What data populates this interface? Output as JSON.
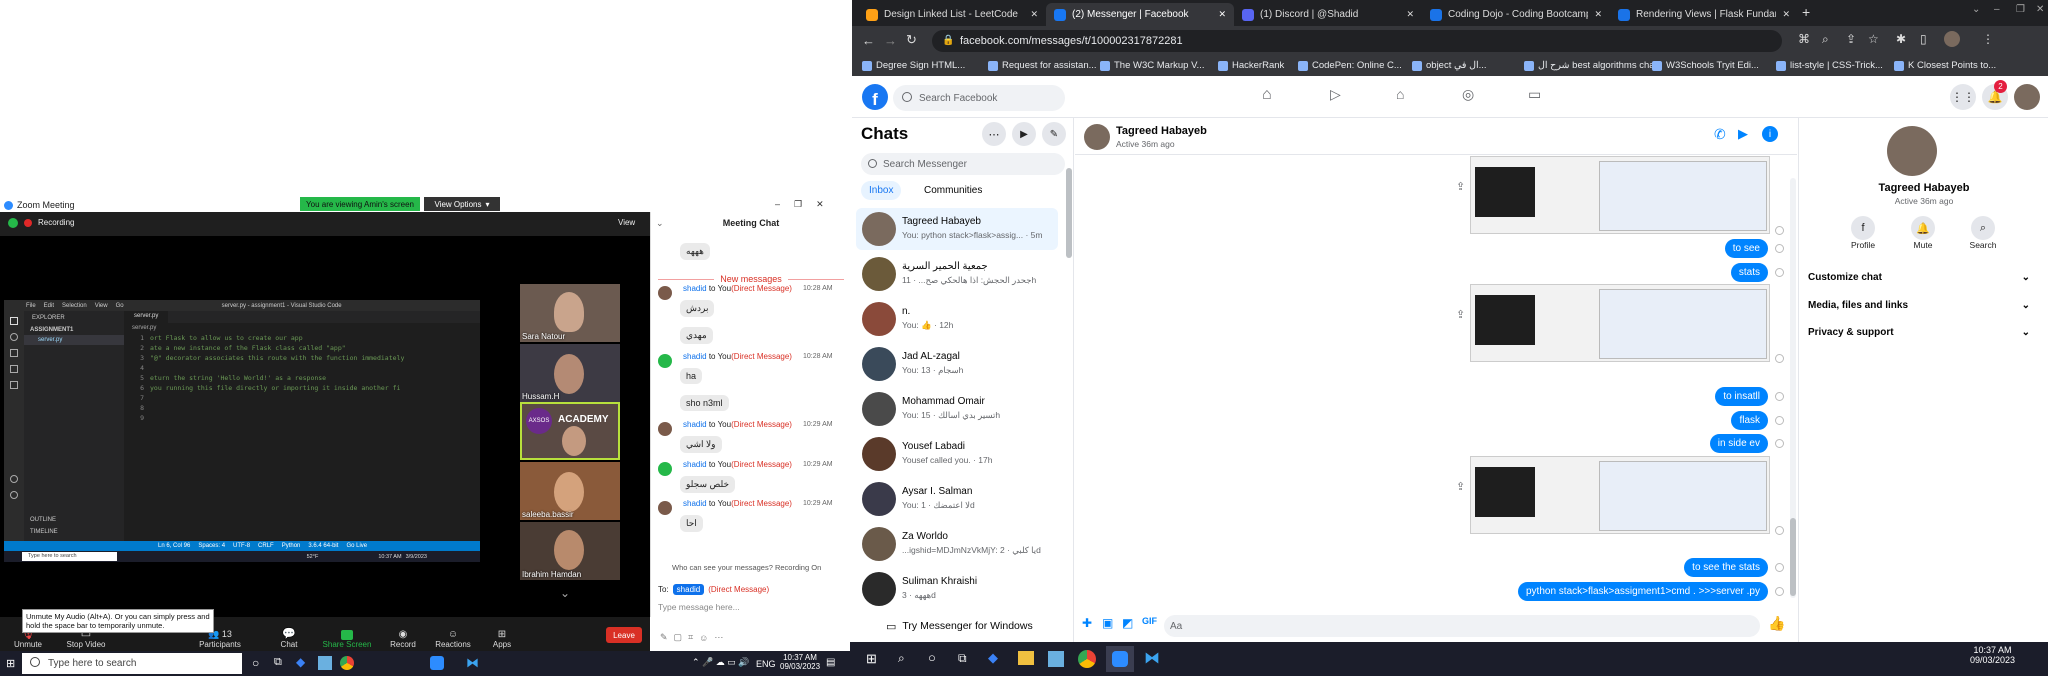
{
  "zoom": {
    "title": "Zoom Meeting",
    "viewing_banner": "You are viewing Amin's screen",
    "view_options": "View Options",
    "recording": "Recording",
    "view": "View",
    "unmute_tip": "Unmute My Audio (Alt+A). Or you can simply press and hold the space bar to temporarily unmute.",
    "toolbar": {
      "unmute": "Unmute",
      "stop_video": "Stop Video",
      "participants": "Participants",
      "participants_count": "13",
      "chat": "Chat",
      "share_screen": "Share Screen",
      "record": "Record",
      "reactions": "Reactions",
      "apps": "Apps",
      "leave": "Leave"
    },
    "participants": [
      {
        "name": "Sara Natour",
        "color": "#6b5a50"
      },
      {
        "name": "Hussam.H",
        "color": "#3d3a44"
      },
      {
        "name": "",
        "color": "#5a4a44",
        "logo": "ACADEMY"
      },
      {
        "name": "saleeba.bassir",
        "color": "#8a5a3a"
      },
      {
        "name": "Ibrahim Hamdan",
        "color": "#4a3c34"
      }
    ],
    "vscode": {
      "title": "server.py - assignment1 - Visual Studio Code",
      "menu": [
        "File",
        "Edit",
        "Selection",
        "View",
        "Go"
      ],
      "explorer_label": "EXPLORER",
      "folder": "ASSIGNMENT1",
      "file": "server.py",
      "tab": "server.py",
      "breadcrumb": "server.py",
      "outline": "OUTLINE",
      "timeline": "TIMELINE",
      "code_lines": [
        "ort Flask to allow us to create our app",
        "ate a new instance of the Flask class called \"app\"",
        "\"@\" decorator associates this route with the function immediately",
        "",
        "eturn the string 'Hello World!' as a response",
        "you running this file directly or importing it inside another fi",
        "",
        "",
        ""
      ],
      "status": [
        "Ln 6, Col 96",
        "Spaces: 4",
        "UTF-8",
        "CRLF",
        "Python",
        "3.6.4 64-bit",
        "Go Live"
      ],
      "taskbar_search": "Type here to search",
      "taskbar_temp": "52°F",
      "taskbar_time": "10:37 AM",
      "taskbar_date": "3/9/2023"
    },
    "chat": {
      "title": "Meeting Chat",
      "new_messages": "New messages",
      "messages": [
        {
          "sender": "",
          "dm": "",
          "time": "",
          "text": "هههه"
        },
        {
          "sender": "shadid",
          "dm": "(Direct Message)",
          "time": "10:28 AM",
          "text": "بردش"
        },
        {
          "sender": "",
          "dm": "",
          "time": "",
          "text": "مهدي"
        },
        {
          "sender": "shadid",
          "dm": "(Direct Message)",
          "time": "10:28 AM",
          "text": "ha"
        },
        {
          "sender": "",
          "dm": "",
          "time": "",
          "text": "sho n3ml"
        },
        {
          "sender": "shadid",
          "dm": "(Direct Message)",
          "time": "10:29 AM",
          "text": "ولا اشي"
        },
        {
          "sender": "shadid",
          "dm": "(Direct Message)",
          "time": "10:29 AM",
          "text": "خلص سجلو"
        },
        {
          "sender": "shadid",
          "dm": "(Direct Message)",
          "time": "10:29 AM",
          "text": "احا"
        }
      ],
      "to_you": "to You",
      "visibility": "Who can see your messages? Recording On",
      "to_label": "To:",
      "to_value": "shadid",
      "to_dm": "(Direct Message)",
      "placeholder": "Type message here..."
    }
  },
  "taskbar_left": {
    "search": "Type here to search",
    "lang": "ENG",
    "time": "10:37 AM",
    "date": "09/03/2023"
  },
  "chrome": {
    "tabs": [
      {
        "title": "Design Linked List - LeetCode",
        "active": false,
        "color": "#ffa116"
      },
      {
        "title": "(2) Messenger | Facebook",
        "active": true,
        "color": "#1877f2"
      },
      {
        "title": "(1) Discord | @Shadid",
        "active": false,
        "color": "#5865f2"
      },
      {
        "title": "Coding Dojo - Coding Bootcamp",
        "active": false,
        "color": "#1a73e8"
      },
      {
        "title": "Rendering Views | Flask Fundame",
        "active": false,
        "color": "#1a73e8"
      }
    ],
    "url": "facebook.com/messages/t/100002317872281",
    "bookmarks": [
      "Degree Sign HTML...",
      "Request for assistan...",
      "The W3C Markup V...",
      "HackerRank",
      "CodePen: Online C...",
      "object ال في...",
      "شرح ال best algorithms cha...",
      "W3Schools Tryit Edi...",
      "list-style | CSS-Trick...",
      "K Closest Points to..."
    ]
  },
  "facebook": {
    "search_placeholder": "Search Facebook",
    "notif_count": "2",
    "chats_title": "Chats",
    "messenger_search": "Search Messenger",
    "tab_inbox": "Inbox",
    "tab_communities": "Communities",
    "conversations": [
      {
        "name": "Tagreed Habayeb",
        "preview": "You: python stack>flask>assig... · 5m",
        "color": "#7a6a5e",
        "selected": true
      },
      {
        "name": "جمعية الحمير السرية",
        "preview": "جحدر الحجش: اذا هالحكي صح... · 11h",
        "color": "#6b5a3a",
        "selected": false
      },
      {
        "name": "n.",
        "preview": "You: 👍 · 12h",
        "color": "#8a4a3a",
        "selected": false
      },
      {
        "name": "Jad AL-zagal",
        "preview": "You: سجام · 13h",
        "color": "#3a4a5a",
        "selected": false
      },
      {
        "name": "Mohammad Omair",
        "preview": "You: تسير بدي اسالك · 15h",
        "color": "#4a4a4a",
        "selected": false
      },
      {
        "name": "Yousef Labadi",
        "preview": "Yousef called you. · 17h",
        "color": "#5a3a2a",
        "selected": false
      },
      {
        "name": "Aysar I. Salman",
        "preview": "You: لا اعتمضك · 1d",
        "color": "#3a3a4a",
        "selected": false
      },
      {
        "name": "Za Worldo",
        "preview": "...igshid=MDJmNzVkMjY: يا كلبي · 2d",
        "color": "#6a5a4a",
        "selected": false
      },
      {
        "name": "Suliman Khraishi",
        "preview": "هههه · 3d",
        "color": "#2a2a2a",
        "selected": false
      }
    ],
    "try_messenger": "Try Messenger for Windows",
    "contact_name": "Tagreed Habayeb",
    "contact_status": "Active 36m ago",
    "sent_messages": [
      {
        "text": "to see"
      },
      {
        "text": "stats"
      },
      {
        "text": "to insatll"
      },
      {
        "text": "flask"
      },
      {
        "text": "in side ev"
      },
      {
        "text": "to see the stats"
      },
      {
        "text": "python stack>flask>assigment1>cmd . >>>server .py"
      }
    ],
    "compose_placeholder": "Aa",
    "info": {
      "name": "Tagreed Habayeb",
      "status": "Active 36m ago",
      "actions": [
        "Profile",
        "Mute",
        "Search"
      ],
      "rows": [
        "Customize chat",
        "Media, files and links",
        "Privacy & support"
      ]
    }
  },
  "taskbar_right": {
    "time": "10:37 AM",
    "date": "09/03/2023"
  }
}
